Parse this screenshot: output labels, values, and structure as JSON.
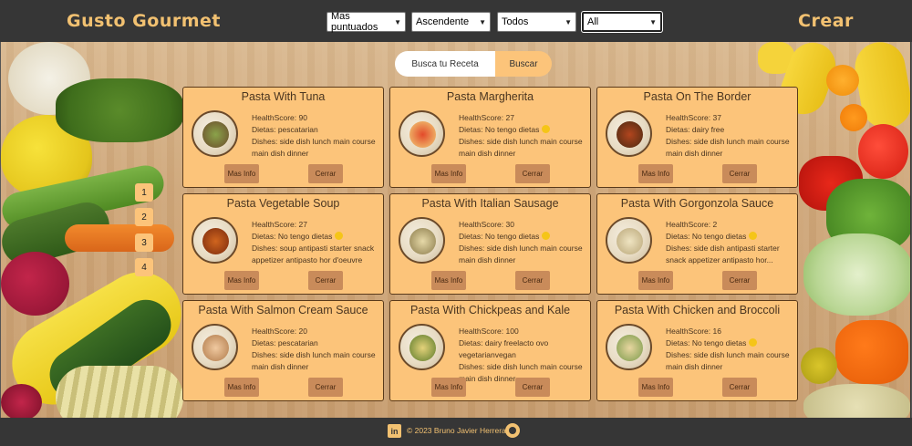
{
  "header": {
    "brand": "Gusto Gourmet",
    "create_label": "Crear",
    "filters": [
      {
        "label": "Mas puntuados"
      },
      {
        "label": "Ascendente"
      },
      {
        "label": "Todos"
      },
      {
        "label": "All"
      }
    ]
  },
  "search": {
    "placeholder": "Busca tu Receta",
    "button_label": "Buscar"
  },
  "pagination": [
    "1",
    "2",
    "3",
    "4"
  ],
  "card_labels": {
    "more_info": "Mas Info",
    "close": "Cerrar"
  },
  "recipes": [
    {
      "title": "Pasta With Tuna",
      "health": "HealthScore: 90",
      "diets": "Dietas: pescatarian",
      "dishes": "Dishes: side dish lunch main course main dish dinner"
    },
    {
      "title": "Pasta Margherita",
      "health": "HealthScore: 27",
      "diets": "Dietas: No tengo dietas",
      "dishes": "Dishes: side dish lunch main course main dish dinner"
    },
    {
      "title": "Pasta On The Border",
      "health": "HealthScore: 37",
      "diets": "Dietas: dairy free",
      "dishes": "Dishes: side dish lunch main course main dish dinner"
    },
    {
      "title": "Pasta Vegetable Soup",
      "health": "HealthScore: 27",
      "diets": "Dietas: No tengo dietas",
      "dishes": "Dishes: soup antipasti starter snack appetizer antipasto hor d'oeuvre"
    },
    {
      "title": "Pasta With Italian Sausage",
      "health": "HealthScore: 30",
      "diets": "Dietas: No tengo dietas",
      "dishes": "Dishes: side dish lunch main course main dish dinner"
    },
    {
      "title": "Pasta With Gorgonzola Sauce",
      "health": "HealthScore: 2",
      "diets": "Dietas: No tengo dietas",
      "dishes": "Dishes: side dish antipasti starter snack appetizer antipasto hor..."
    },
    {
      "title": "Pasta With Salmon Cream Sauce",
      "health": "HealthScore: 20",
      "diets": "Dietas: pescatarian",
      "dishes": "Dishes: side dish lunch main course main dish dinner"
    },
    {
      "title": "Pasta With Chickpeas and Kale",
      "health": "HealthScore: 100",
      "diets": "Dietas: dairy freelacto ovo vegetarianvegan",
      "dishes": "Dishes: side dish lunch main course main dish dinner"
    },
    {
      "title": "Pasta With Chicken and Broccoli",
      "health": "HealthScore: 16",
      "diets": "Dietas: No tengo dietas",
      "dishes": "Dishes: side dish lunch main course main dish dinner"
    }
  ],
  "footer": {
    "copyright": "© 2023 Bruno Javier Herrera",
    "linkedin_icon": "in"
  },
  "colors": {
    "accent": "#f2c171",
    "card": "#fcc47a",
    "button": "#c98b5a",
    "bar": "#363636"
  }
}
